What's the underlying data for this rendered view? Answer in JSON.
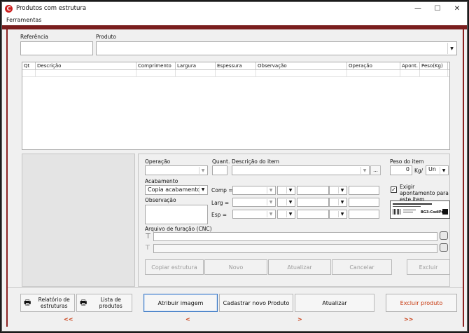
{
  "window": {
    "title": "Produtos com estrutura",
    "app_icon_letter": "C",
    "controls": {
      "minimize": "—",
      "maximize": "☐",
      "close": "✕"
    }
  },
  "menu": {
    "items": [
      "Ferramentas"
    ]
  },
  "header": {
    "referencia_label": "Referência",
    "referencia_value": "",
    "produto_label": "Produto",
    "produto_value": "",
    "produto_arrow": "▼"
  },
  "table": {
    "columns": [
      "Qt",
      "Descrição",
      "Comprimento",
      "Largura",
      "Espessura",
      "Observação",
      "Operação",
      "Apont.",
      "Peso(Kg)"
    ]
  },
  "item_form": {
    "operacao_label": "Operação",
    "operacao_value": "",
    "quant_label": "Quant.",
    "quant_value": "",
    "descricao_label": "Descrição do item",
    "descricao_value": "",
    "browse_label": "...",
    "peso_label": "Peso do item",
    "peso_value": "0",
    "peso_unit": "Kg/",
    "unit_value": "Un",
    "acabamento_label": "Acabamento",
    "acabamento_value": "Copia acabamento",
    "observacao_label": "Observação",
    "observacao_value": "",
    "dim_labels": [
      "Comp =",
      "Larg =",
      "Esp ="
    ],
    "exigir_label": "Exigir apontamento para este item",
    "exigir_checked": "✓",
    "arquivo_label": "Arquivo de furação (CNC)",
    "barcode_code": "BG3-CodiPra"
  },
  "actions": {
    "copiar": "Copiar estrutura",
    "novo": "Novo",
    "atualizar": "Atualizar",
    "cancelar": "Cancelar",
    "excluir": "Excluir"
  },
  "footer": {
    "relatorio_label": "Relatório de estruturas",
    "lista_label": "Lista de produtos",
    "atribuir_label": "Atribuir imagem",
    "cadastrar_label": "Cadastrar novo Produto",
    "atualizar_label": "Atualizar",
    "excluir_label": "Excluir produto",
    "nav_first": "<<",
    "nav_prev": "<",
    "nav_next": ">",
    "nav_last": ">>"
  },
  "colors": {
    "accent": "#c83a10",
    "band": "#7a1e1e",
    "focus": "#3a77c4"
  }
}
